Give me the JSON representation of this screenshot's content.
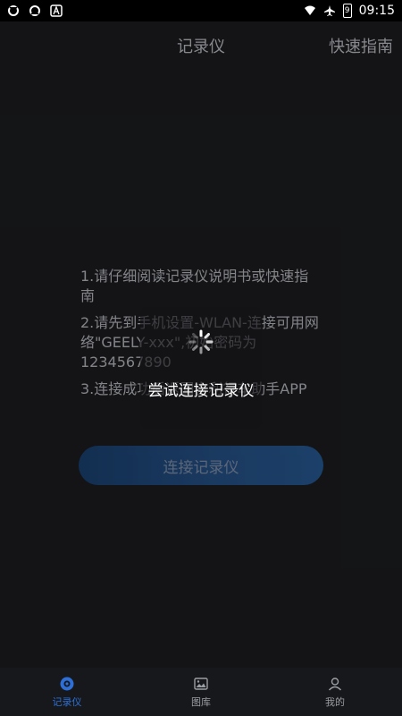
{
  "status_bar": {
    "time": "09:15",
    "battery_level": "9",
    "left_icons": [
      "sync-icon",
      "sync-icon",
      "text-a-icon"
    ],
    "right_icons": [
      "wifi-icon",
      "airplane-icon",
      "battery-icon"
    ]
  },
  "app_bar": {
    "title": "记录仪",
    "guide_label": "快速指南"
  },
  "instructions": [
    "1.请仔细阅读记录仪说明书或快速指南",
    "2.请先到手机设置-WLAN-连接可用网络\"GEELY-xxx\",初始密码为1234567890",
    "3.连接成功后返回吉利行车助手APP"
  ],
  "connect_button": {
    "label": "连接记录仪"
  },
  "loading_dialog": {
    "text": "尝试连接记录仪",
    "icon": "spinner-icon"
  },
  "bottom_nav": {
    "items": [
      {
        "label": "记录仪",
        "icon": "dashcam-icon",
        "active": true
      },
      {
        "label": "图库",
        "icon": "gallery-icon",
        "active": false
      },
      {
        "label": "我的",
        "icon": "profile-icon",
        "active": false
      }
    ]
  },
  "colors": {
    "background": "#1f2024",
    "accent": "#2d6fd6",
    "button_gradient_start": "#1c4f8c",
    "button_gradient_end": "#2c6fb8"
  }
}
